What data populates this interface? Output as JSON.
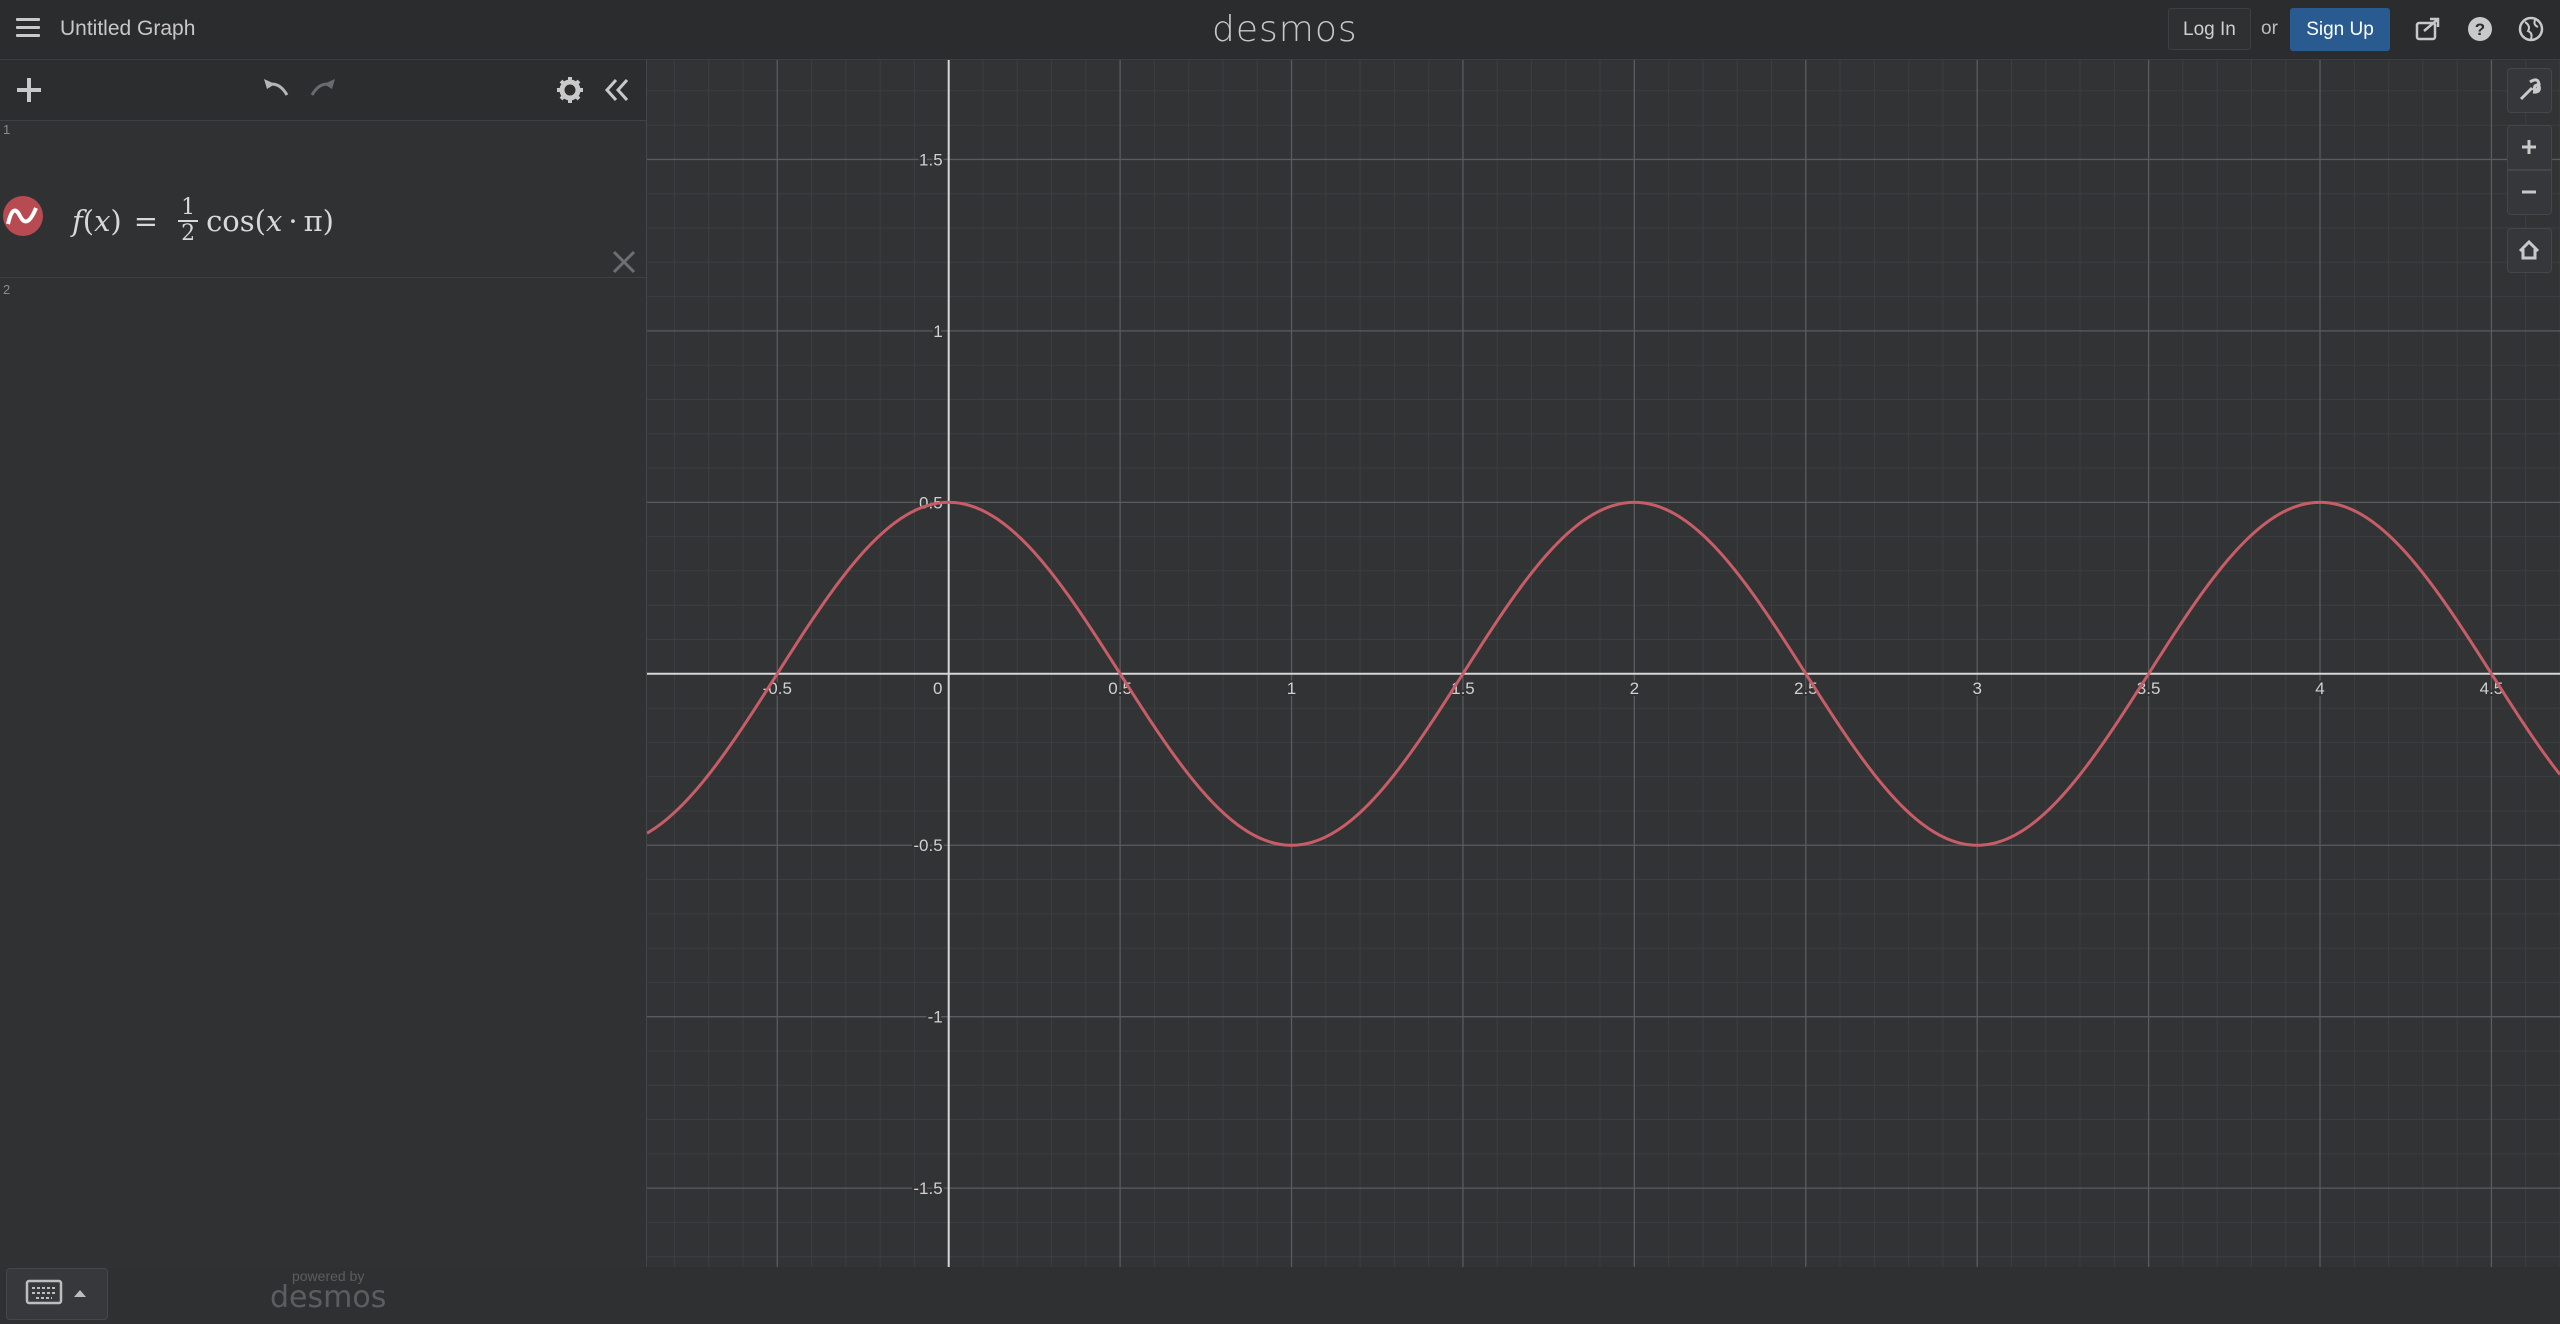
{
  "header": {
    "graph_title": "Untitled Graph",
    "brand": "desmos",
    "login_label": "Log In",
    "or_label": "or",
    "signup_label": "Sign Up"
  },
  "expressions": [
    {
      "index": "1",
      "latex_display": "f(x) = 1/2 cos(x·π)",
      "color": "#b84a52"
    },
    {
      "index": "2"
    }
  ],
  "expr1": {
    "f": "f",
    "x": "x",
    "eq": "=",
    "num": "1",
    "den": "2",
    "cos": "cos",
    "x2": "x",
    "dot": "·",
    "pi": "π"
  },
  "footer": {
    "powered_by": "powered by",
    "brand": "desmos"
  },
  "graph": {
    "curve_color": "#c75d66",
    "x_range": [
      -0.88,
      4.7
    ],
    "y_range": [
      -1.73,
      1.79
    ],
    "x_ticks": [
      "-0.5",
      "0",
      "0.5",
      "1",
      "1.5",
      "2",
      "2.5",
      "3",
      "3.5",
      "4",
      "4.5"
    ],
    "y_ticks": [
      "1.5",
      "1",
      "0.5",
      "-0.5",
      "-1",
      "-1.5"
    ],
    "function": "0.5*cos(pi*x)"
  },
  "chart_data": {
    "type": "line",
    "series": [
      {
        "x": [
          -0.88,
          -0.5,
          0,
          0.5,
          1,
          1.5,
          2,
          2.5,
          3,
          3.5,
          4,
          4.5,
          4.7
        ],
        "y": [
          -0.465,
          0,
          0.5,
          0,
          -0.5,
          0,
          0.5,
          0,
          -0.5,
          0,
          0.5,
          0,
          -0.294
        ]
      }
    ],
    "xlim": [
      -0.88,
      4.7
    ],
    "ylim": [
      -1.73,
      1.79
    ],
    "grid": true
  }
}
